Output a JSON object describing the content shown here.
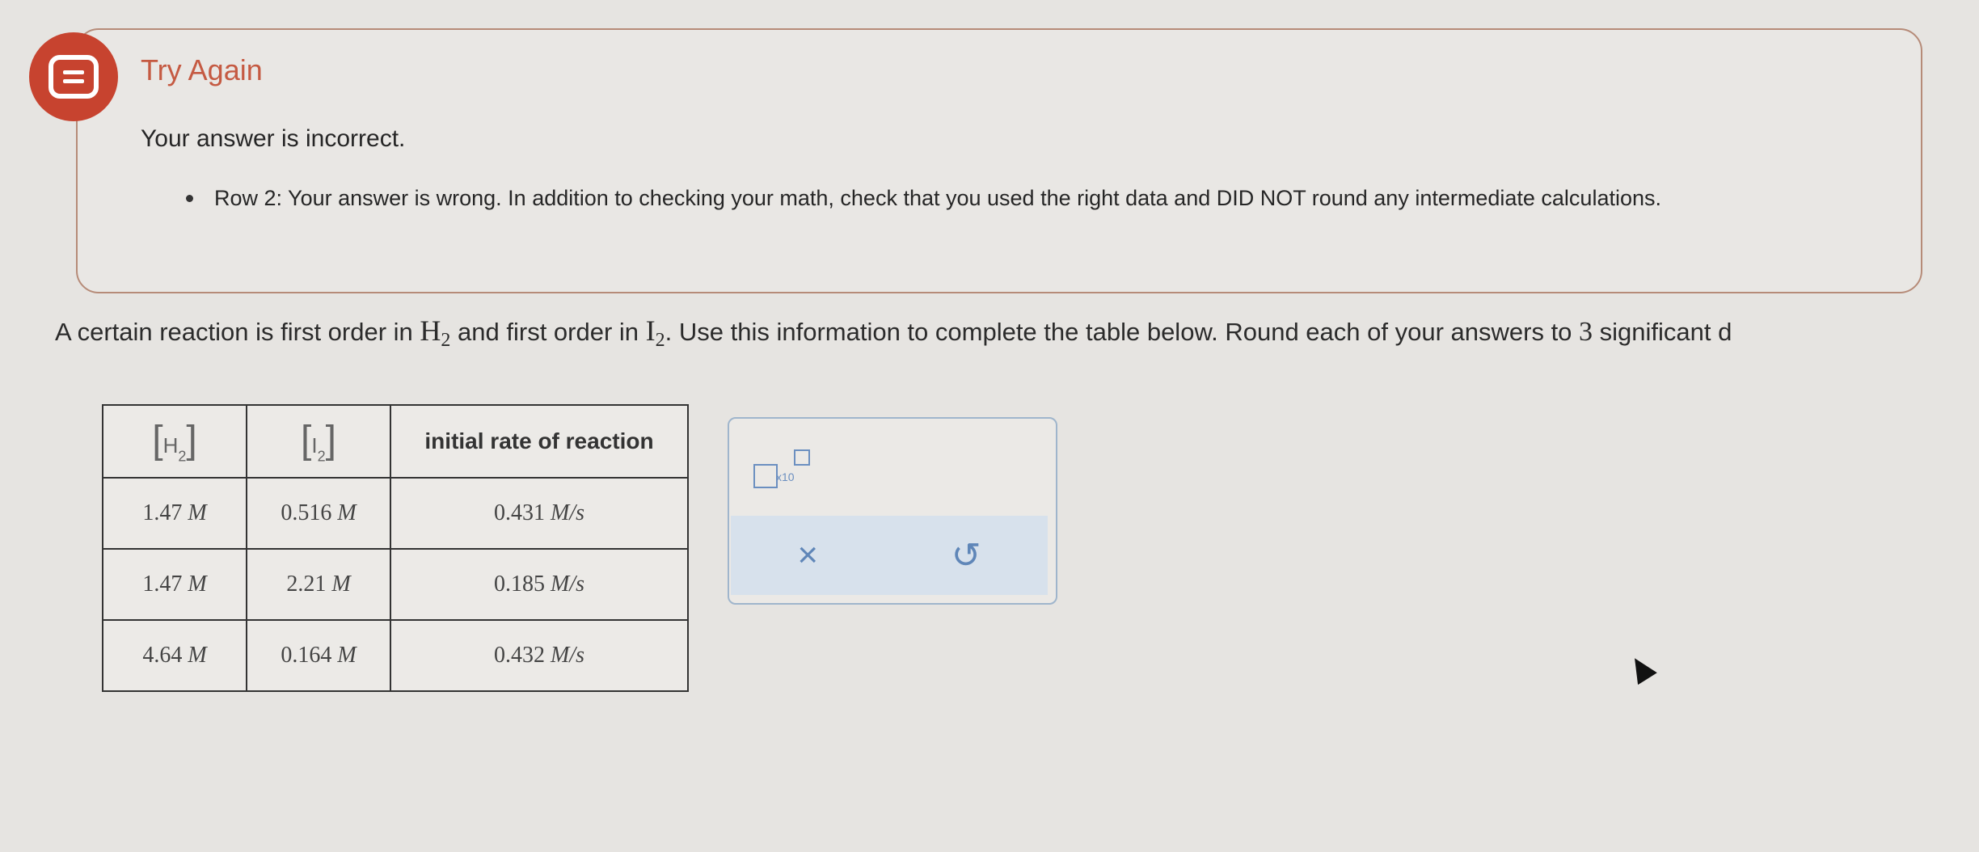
{
  "feedback": {
    "title": "Try Again",
    "message": "Your answer is incorrect.",
    "bullet": "Row 2: Your answer is wrong. In addition to checking your math, check that you used the right data and DID NOT round any intermediate calculations.",
    "icon": "message-icon",
    "accent_color": "#c7432f"
  },
  "question": {
    "part1": "A certain reaction is first order in ",
    "h2": "H",
    "sub": "2",
    "part2": " and first order in ",
    "i2": "I",
    "part3": ". Use this information to complete the table below. Round each of your answers to ",
    "sigfigs": "3",
    "part4": " significant d"
  },
  "table": {
    "headers": [
      {
        "symbol": "H",
        "sub": "2"
      },
      {
        "symbol": "I",
        "sub": "2"
      },
      {
        "label": "initial rate of reaction"
      }
    ],
    "rows": [
      {
        "h2": "1.47",
        "h2_unit": "M",
        "i2": "0.516",
        "i2_unit": "M",
        "rate": "0.431",
        "rate_unit": "M/s"
      },
      {
        "h2": "1.47",
        "h2_unit": "M",
        "i2": "2.21",
        "i2_unit": "M",
        "rate": "0.185",
        "rate_unit": "M/s"
      },
      {
        "h2": "4.64",
        "h2_unit": "M",
        "i2": "0.164",
        "i2_unit": "M",
        "rate": "0.432",
        "rate_unit": "M/s"
      }
    ]
  },
  "tool": {
    "sci_label": "x10",
    "clear_label": "×",
    "undo_label": "↺"
  }
}
